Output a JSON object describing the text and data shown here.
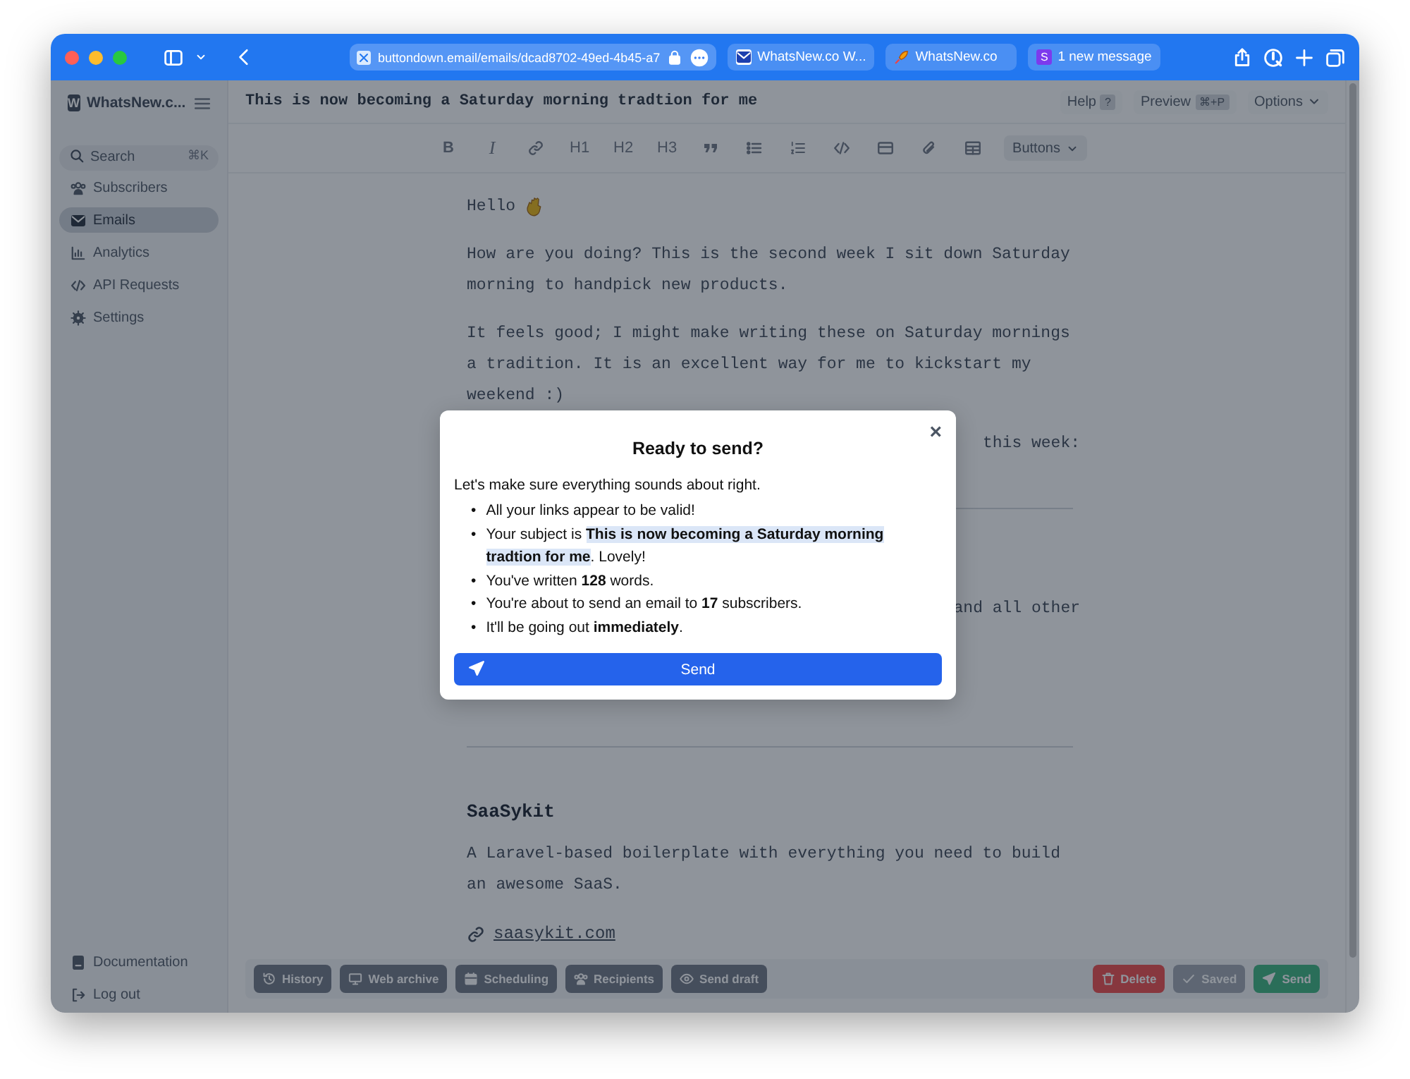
{
  "browser": {
    "address": "buttondown.email/emails/dcad8702-49ed-4b45-a7",
    "tabs": [
      {
        "label": "WhatsNew.co W...",
        "selected": false
      },
      {
        "label": "WhatsNew.co",
        "selected": false
      },
      {
        "label": "1 new message",
        "selected": false,
        "favicon_letter": "S"
      }
    ]
  },
  "sidebar": {
    "workspace": "WhatsNew.c...",
    "workspace_letter": "W",
    "search": {
      "placeholder": "Search",
      "shortcut": "⌘K"
    },
    "items": [
      {
        "label": "Subscribers",
        "selected": false
      },
      {
        "label": "Emails",
        "selected": true
      },
      {
        "label": "Analytics",
        "selected": false
      },
      {
        "label": "API Requests",
        "selected": false
      },
      {
        "label": "Settings",
        "selected": false
      }
    ],
    "footer_items": [
      {
        "label": "Documentation"
      },
      {
        "label": "Log out"
      }
    ]
  },
  "header": {
    "subject": "This is now becoming a Saturday morning tradtion for me",
    "help": "Help",
    "help_key": "?",
    "preview": "Preview",
    "preview_key": "⌘+P",
    "options": "Options"
  },
  "format_toolbar": {
    "labels": [
      "B",
      "I",
      "H1",
      "H2",
      "H3"
    ],
    "menu": "Buttons"
  },
  "editor": [
    {
      "kind": "greeting",
      "text": "Hello"
    },
    {
      "kind": "paragraph",
      "text": "How are you doing? This is the second week I sit down Saturday morning to handpick new products."
    },
    {
      "kind": "paragraph",
      "text": "It feels good; I might make writing these on Saturday mornings a tradition. It is an excellent way for me to kickstart my weekend :)"
    },
    {
      "kind": "partial",
      "text": "this week:"
    },
    {
      "kind": "rule"
    },
    {
      "kind": "partial",
      "text": "and all other"
    },
    {
      "kind": "rule"
    },
    {
      "kind": "heading",
      "text": "SaaSykit"
    },
    {
      "kind": "paragraph",
      "text": "A Laravel-based boilerplate with everything you need to build an awesome SaaS."
    },
    {
      "kind": "link",
      "text": "saasykit.com"
    }
  ],
  "bottom_bar": {
    "left": [
      "History",
      "Web archive",
      "Scheduling",
      "Recipients",
      "Send draft"
    ],
    "right": [
      {
        "label": "Delete",
        "kind": "danger"
      },
      {
        "label": "Saved",
        "kind": "neutral"
      },
      {
        "label": "Send",
        "kind": "success"
      }
    ]
  },
  "modal": {
    "title": "Ready to send?",
    "close": "×",
    "bullet": "•",
    "intro": "Let's make sure everything sounds about right.",
    "checks": [
      {
        "text": "All your links appear to be valid!",
        "highlight": false
      },
      {
        "text": "Your subject is **This is now becoming a Saturday morning tradtion for me**. Lovely!",
        "highlight": true
      },
      {
        "text": "You've written **128** words.",
        "highlight": false
      },
      {
        "text": "You're about to send an email to **17** subscribers.",
        "highlight": false
      },
      {
        "text": "It'll be going out **immediately**.",
        "highlight": false
      }
    ],
    "button": "Send"
  }
}
